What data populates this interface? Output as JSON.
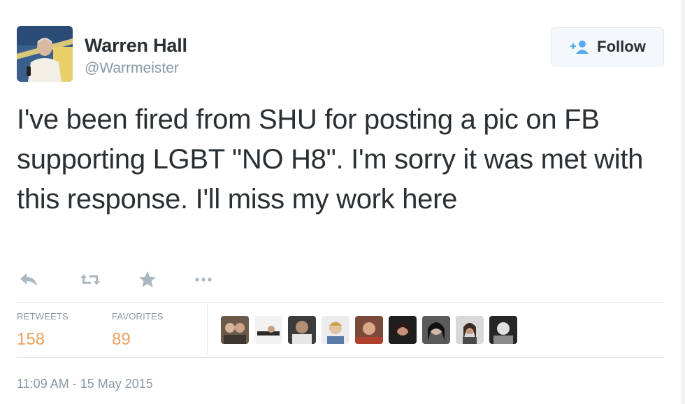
{
  "user": {
    "name": "Warren Hall",
    "handle": "@Warrmeister"
  },
  "follow_button": {
    "label": "Follow",
    "icon": "add-user-icon"
  },
  "tweet": {
    "text": "I've been fired from SHU for posting a pic on FB supporting LGBT \"NO H8\". I'm sorry it was met with this response. I'll miss my work here"
  },
  "actions": [
    {
      "name": "reply",
      "icon": "reply-icon"
    },
    {
      "name": "retweet",
      "icon": "retweet-icon"
    },
    {
      "name": "favorite",
      "icon": "star-icon"
    },
    {
      "name": "more",
      "icon": "more-dots-icon"
    }
  ],
  "stats": {
    "retweets_label": "RETWEETS",
    "retweets_value": "158",
    "favorites_label": "FAVORITES",
    "favorites_value": "89"
  },
  "favoriters_count_shown": 9,
  "timestamp": "11:09 AM - 15 May 2015",
  "colors": {
    "text": "#292f33",
    "muted": "#8899a6",
    "stat_value": "#e8a05f",
    "follow_icon": "#55acee",
    "border": "#e1e8ed"
  }
}
